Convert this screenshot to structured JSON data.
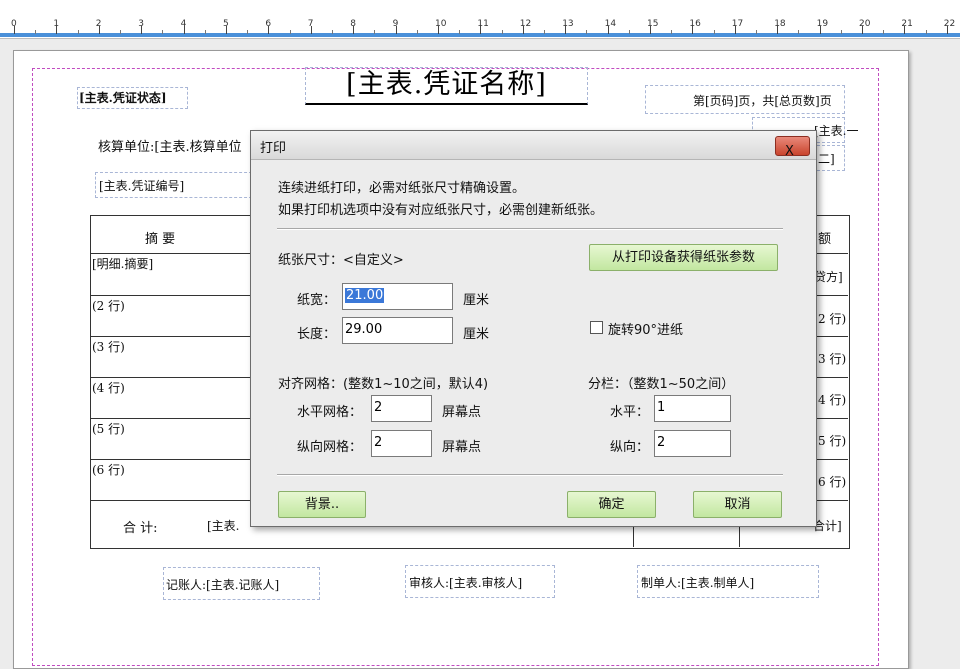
{
  "ruler": {
    "labels": [
      "0",
      "1",
      "2",
      "3",
      "4",
      "5",
      "6",
      "7",
      "8",
      "9",
      "10",
      "11",
      "12",
      "13",
      "14",
      "15",
      "16",
      "17",
      "18",
      "19",
      "20",
      "21",
      "22"
    ]
  },
  "report": {
    "status_field": "[主表.凭证状态]",
    "title": "[主表.凭证名称]",
    "page_info": "第[页码]页，共[总页数]页",
    "accounting_unit_label": "核算单位:[主表.核算单位",
    "voucher_no": "[主表.凭证编号]",
    "right_top_1": "[主表.一",
    "right_top_2": "二]",
    "col_summary": "摘     要",
    "col_amount": "额",
    "detail_row_1": "[明细.摘要]",
    "rows": [
      "(2 行)",
      "(3 行)",
      "(4 行)",
      "(5 行)",
      "(6 行)"
    ],
    "right_col_1": "贷方]",
    "right_col_rows": [
      "2 行)",
      "3 行)",
      "4 行)",
      "5 行)",
      "6 行)"
    ],
    "total_label": "合    计:",
    "total_value": "[主表.",
    "total_right": "合计]",
    "bookkeeper": "记账人:[主表.记账人]",
    "reviewer": "审核人:[主表.审核人]",
    "maker": "制单人:[主表.制单人]"
  },
  "dialog": {
    "title": "打印",
    "close_label": "X",
    "info_line_1": "连续进纸打印，必需对纸张尺寸精确设置。",
    "info_line_2": "如果打印机选项中没有对应纸张尺寸，必需创建新纸张。",
    "paper_size_label": "纸张尺寸：<自定义>",
    "get_params_button": "从打印设备获得纸张参数",
    "width_label": "纸宽：",
    "width_value": "21.00",
    "length_label": "长度：",
    "length_value": "29.00",
    "unit_cm_1": "厘米",
    "unit_cm_2": "厘米",
    "rotate_label": "旋转90°进纸",
    "rotate_checked": false,
    "grid_title": "对齐网格：(整数1~10之间，默认4)",
    "columns_title": "分栏：（整数1~50之间）",
    "h_grid_label": "水平网格：",
    "h_grid_value": "2",
    "v_grid_label": "纵向网格：",
    "v_grid_value": "2",
    "unit_px_1": "屏幕点",
    "unit_px_2": "屏幕点",
    "h_col_label": "水平：",
    "h_col_value": "1",
    "v_col_label": "纵向：",
    "v_col_value": "2",
    "background_button": "背景..",
    "ok_button": "确定",
    "cancel_button": "取消"
  },
  "colors": {
    "ruler_bar": "#4a90d9",
    "print_frame": "#c04cc0",
    "close_button": "#c9442d",
    "button_green": "#c2e7a0",
    "selection": "#3b78d8"
  }
}
